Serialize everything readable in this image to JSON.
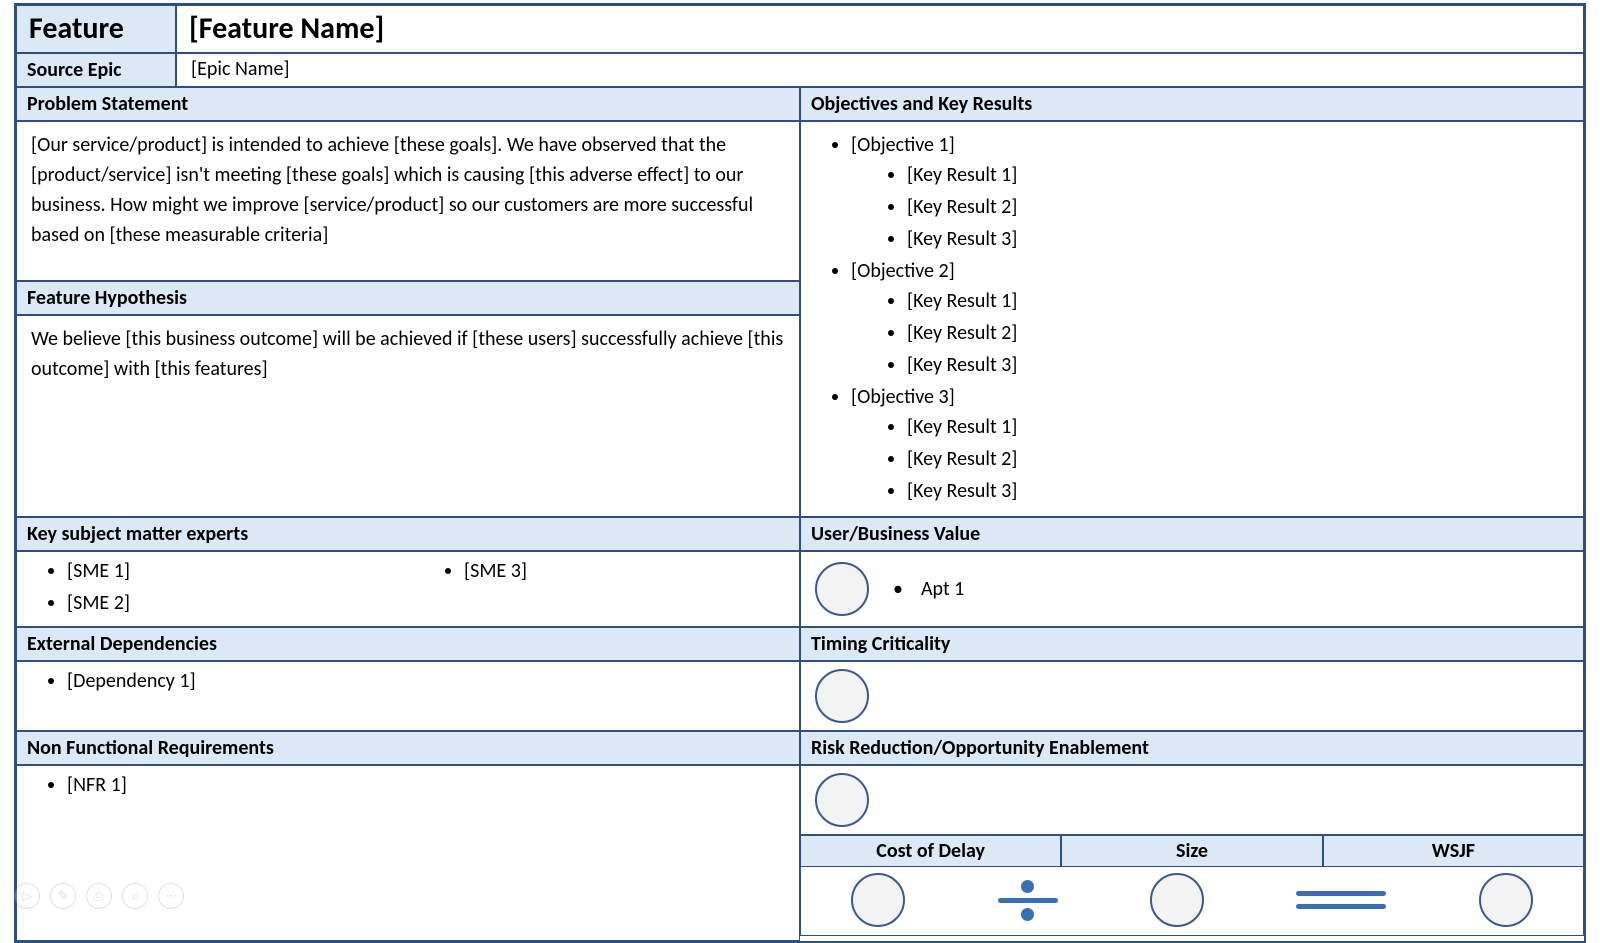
{
  "header": {
    "feature_label": "Feature",
    "feature_value": "[Feature Name]",
    "source_epic_label": "Source Epic",
    "source_epic_value": "[Epic Name]"
  },
  "sections": {
    "problem_statement": {
      "title": "Problem Statement",
      "body": "[Our service/product] is intended to achieve [these goals].  We have observed that the [product/service] isn't meeting [these goals] which is causing [this adverse effect] to our business.  How might we improve [service/product] so our customers are more successful based on [these measurable criteria]"
    },
    "feature_hypothesis": {
      "title": "Feature Hypothesis",
      "body": "We believe [this business outcome] will be achieved if [these users] successfully achieve [this outcome] with [this features]"
    },
    "okr": {
      "title": "Objectives and Key Results",
      "objectives": [
        {
          "label": "[Objective 1]",
          "krs": [
            "[Key Result 1]",
            "[Key Result 2]",
            "[Key Result 3]"
          ]
        },
        {
          "label": "[Objective 2]",
          "krs": [
            "[Key Result 1]",
            "[Key Result 2]",
            "[Key Result 3]"
          ]
        },
        {
          "label": "[Objective 3]",
          "krs": [
            "[Key Result 1]",
            "[Key Result 2]",
            "[Key Result 3]"
          ]
        }
      ]
    },
    "sme": {
      "title": "Key subject matter experts",
      "left": [
        "[SME 1]",
        "[SME 2]"
      ],
      "right": [
        "[SME 3]"
      ]
    },
    "ext_deps": {
      "title": "External Dependencies",
      "items": [
        "[Dependency 1]"
      ]
    },
    "nfr": {
      "title": "Non Functional Requirements",
      "items": [
        "[NFR 1]"
      ]
    },
    "user_business_value": {
      "title": "User/Business Value",
      "item": "Apt 1"
    },
    "timing_criticality": {
      "title": "Timing Criticality"
    },
    "risk_reduction": {
      "title": "Risk Reduction/Opportunity Enablement"
    },
    "wsjf": {
      "cost_of_delay": "Cost of Delay",
      "size": "Size",
      "wsjf": "WSJF"
    }
  },
  "toolbar": {
    "play": "▷",
    "edit": "✎",
    "clipboard": "⎙",
    "zoom": "⌕",
    "more": "⋯"
  }
}
